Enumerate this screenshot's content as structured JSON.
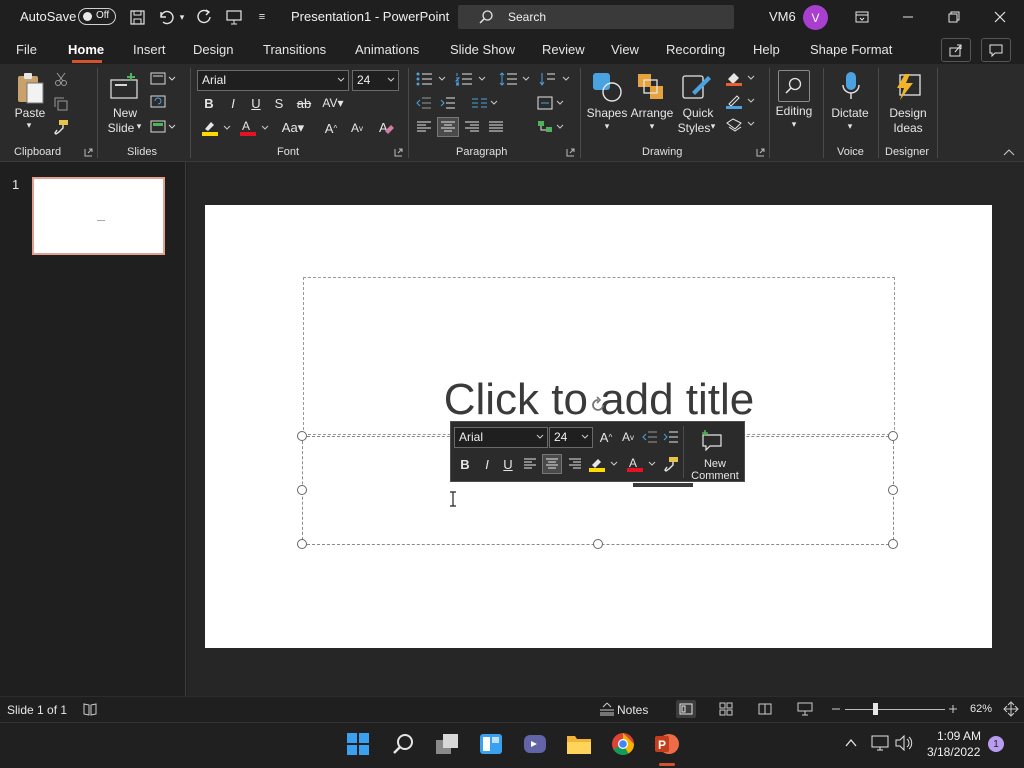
{
  "titlebar": {
    "autosave_label": "AutoSave",
    "autosave_state": "Off",
    "document_title": "Presentation1  -  PowerPoint",
    "search_placeholder": "Search",
    "user_name": "VM6",
    "avatar_initial": "V"
  },
  "tabs": [
    "File",
    "Home",
    "Insert",
    "Design",
    "Transitions",
    "Animations",
    "Slide Show",
    "Review",
    "View",
    "Recording",
    "Help",
    "Shape Format"
  ],
  "ribbon": {
    "clipboard": {
      "paste": "Paste",
      "label": "Clipboard"
    },
    "slides": {
      "new_slide_1": "New",
      "new_slide_2": "Slide",
      "label": "Slides"
    },
    "font": {
      "family": "Arial",
      "size": "24",
      "label": "Font"
    },
    "paragraph": {
      "label": "Paragraph"
    },
    "drawing": {
      "shapes": "Shapes",
      "arrange": "Arrange",
      "quick_1": "Quick",
      "quick_2": "Styles",
      "label": "Drawing"
    },
    "editing": {
      "label": "Editing"
    },
    "voice": {
      "dictate": "Dictate",
      "label": "Voice"
    },
    "designer": {
      "design_1": "Design",
      "design_2": "Ideas",
      "label": "Designer"
    }
  },
  "thumbnails": {
    "slide_number": "1"
  },
  "slide": {
    "title_placeholder": "Click to add title"
  },
  "mini_toolbar": {
    "font": "Arial",
    "size": "24",
    "new_comment_1": "New",
    "new_comment_2": "Comment"
  },
  "statusbar": {
    "slide_count": "Slide 1 of 1",
    "notes": "Notes",
    "zoom": "62%",
    "zoom_level": 0.3
  },
  "taskbar": {
    "time": "1:09 AM",
    "date": "3/18/2022",
    "notification_count": "1"
  },
  "colors": {
    "accent": "#d35230",
    "avatar": "#a93fcf",
    "font_color": "#e81123",
    "highlight": "#ffd800"
  }
}
